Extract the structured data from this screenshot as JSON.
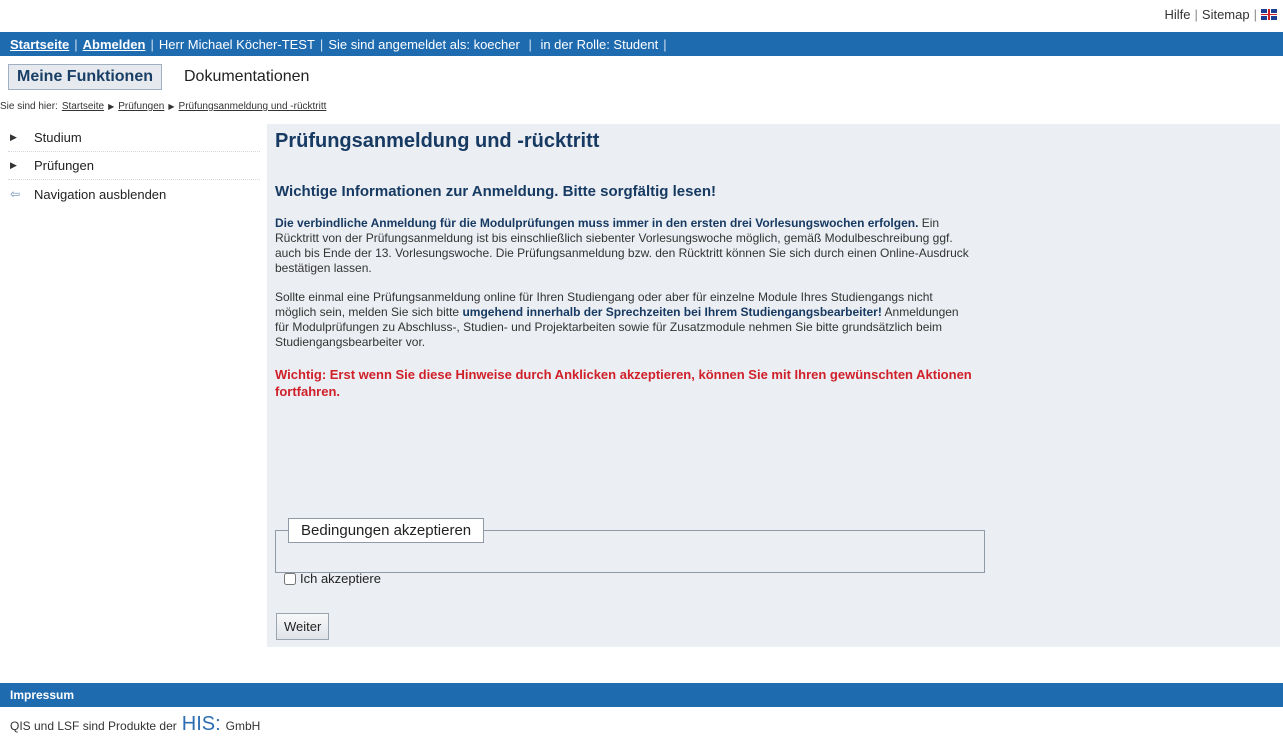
{
  "util": {
    "help": "Hilfe",
    "sitemap": "Sitemap",
    "lang_icon": "uk-flag-icon"
  },
  "topbar": {
    "home": "Startseite",
    "logout": "Abmelden",
    "user": "Herr Michael Köcher-TEST",
    "logged_in_as": "Sie sind angemeldet als: koecher",
    "role": "in der Rolle: Student"
  },
  "tabs": {
    "active": "Meine Funktionen",
    "other": "Dokumentationen"
  },
  "breadcrumb": {
    "prefix": "Sie sind hier:",
    "items": [
      "Startseite",
      "Prüfungen",
      "Prüfungsanmeldung und -rücktritt"
    ]
  },
  "nav": {
    "items": [
      "Studium",
      "Prüfungen"
    ],
    "hide": "Navigation ausblenden"
  },
  "main": {
    "title": "Prüfungsanmeldung und -rücktritt",
    "subtitle": "Wichtige Informationen zur Anmeldung. Bitte sorgfältig lesen!",
    "p1_bold": "Die verbindliche Anmeldung für die Modulprüfungen muss immer in den ersten drei Vorlesungswochen erfolgen.",
    "p1_rest": " Ein Rücktritt von der Prüfungsanmeldung ist bis einschließlich siebenter Vorlesungswoche möglich, gemäß Modulbeschreibung ggf. auch bis Ende der 13. Vorlesungswoche. Die Prüfungsanmeldung bzw. den Rücktritt können Sie sich durch einen Online-Ausdruck bestätigen lassen.",
    "p2_a": "Sollte einmal eine Prüfungsanmeldung online für Ihren Studiengang oder aber für einzelne Module Ihres Studiengangs nicht möglich sein, melden Sie sich bitte ",
    "p2_bold": "umgehend innerhalb der Sprechzeiten bei Ihrem Studiengangsbearbeiter!",
    "p2_b": " Anmeldungen für Modulprüfungen zu Abschluss-, Studien- und Projektarbeiten sowie für Zusatzmodule nehmen Sie bitte grundsätzlich beim Studiengangsbearbeiter vor.",
    "warning": "Wichtig: Erst wenn Sie diese Hinweise durch Anklicken akzeptieren, können Sie mit Ihren gewünschten Aktionen fortfahren.",
    "fieldset_legend": "Bedingungen akzeptieren",
    "checkbox_label": "Ich akzeptiere",
    "checkbox_checked": false,
    "next_button": "Weiter"
  },
  "footer": {
    "impressum": "Impressum",
    "text": "QIS und LSF sind Produkte der",
    "logo": "HIS",
    "logo_suffix": "GmbH"
  },
  "colors": {
    "bar_blue": "#1f6bb0",
    "heading_blue": "#173a63",
    "warning_red": "#d0202a",
    "panel_bg": "#ebeef2"
  }
}
